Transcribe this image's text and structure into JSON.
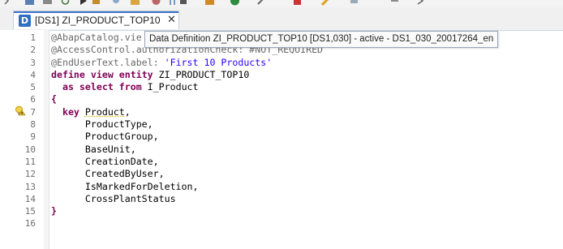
{
  "editor": {
    "tab_title": "[DS1] ZI_PRODUCT_TOP10",
    "tab_icon_letter": "D",
    "close_glyph": "✕",
    "tooltip": "Data Definition ZI_PRODUCT_TOP10 [DS1,030] - active - DS1_030_20017264_en",
    "lines": [
      {
        "n": "1",
        "text": "@AbapCatalog.vie"
      },
      {
        "n": "2",
        "text": "@AccessControl.authorizationCheck: #NOT_REQUIRED"
      },
      {
        "n": "3",
        "text": "@EndUserText.label: 'First 10 Products'"
      },
      {
        "n": "4",
        "text": "define view entity ZI_PRODUCT_TOP10"
      },
      {
        "n": "5",
        "text": "  as select from I_Product"
      },
      {
        "n": "6",
        "text": "{"
      },
      {
        "n": "7",
        "text": "  key Product,"
      },
      {
        "n": "8",
        "text": "      ProductType,"
      },
      {
        "n": "9",
        "text": "      ProductGroup,"
      },
      {
        "n": "10",
        "text": "      BaseUnit,"
      },
      {
        "n": "11",
        "text": "      CreationDate,"
      },
      {
        "n": "12",
        "text": "      CreatedByUser,"
      },
      {
        "n": "13",
        "text": "      IsMarkedForDeletion,"
      },
      {
        "n": "14",
        "text": "      CrossPlantStatus"
      },
      {
        "n": "15",
        "text": "}"
      },
      {
        "n": "16",
        "text": ""
      }
    ]
  },
  "colors": {
    "keyword": "#7f0055",
    "string": "#2a00ff",
    "annotation": "#6a6a6a",
    "tab_accent": "#3a73c8"
  },
  "icons": [
    "warning-lightbulb-icon",
    "data-definition-icon",
    "close-icon"
  ]
}
